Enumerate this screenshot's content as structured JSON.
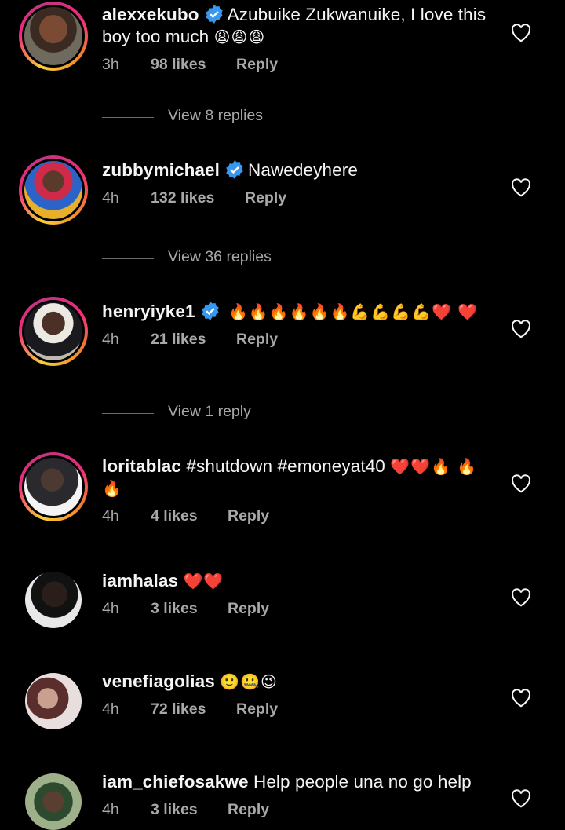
{
  "comments": [
    {
      "username": "alexxekubo",
      "verified": true,
      "text": "Azubuike Zukwanuike, I love this boy too much",
      "emojis": "😩😩😩",
      "time": "3h",
      "likes": "98 likes",
      "reply": "Reply",
      "view_replies": "View 8 replies",
      "story_ring": true
    },
    {
      "username": "zubbymichael",
      "verified": true,
      "text": "Nawedeyhere",
      "emojis": "",
      "time": "4h",
      "likes": "132 likes",
      "reply": "Reply",
      "view_replies": "View 36 replies",
      "story_ring": true
    },
    {
      "username": "henryiyke1",
      "verified": true,
      "text": "",
      "emojis": "🔥🔥🔥🔥🔥🔥💪💪💪💪❤️ ❤️",
      "time": "4h",
      "likes": "21 likes",
      "reply": "Reply",
      "view_replies": "View 1 reply",
      "story_ring": true
    },
    {
      "username": "loritablac",
      "verified": false,
      "text": "#shutdown #emoneyat40",
      "emojis": "❤️❤️🔥 🔥🔥",
      "time": "4h",
      "likes": "4 likes",
      "reply": "Reply",
      "story_ring": true
    },
    {
      "username": "iamhalas",
      "verified": false,
      "text": "",
      "emojis": "❤️❤️",
      "time": "4h",
      "likes": "3 likes",
      "reply": "Reply",
      "story_ring": false
    },
    {
      "username": "venefiagolias",
      "verified": false,
      "text": "",
      "emojis": "🙂🤐😉",
      "time": "4h",
      "likes": "72 likes",
      "reply": "Reply",
      "story_ring": false
    },
    {
      "username": "iam_chiefosakwe",
      "verified": false,
      "text": "Help people una no go help",
      "emojis": "",
      "time": "4h",
      "likes": "3 likes",
      "reply": "Reply",
      "story_ring": false
    }
  ],
  "colors": {
    "background": "#000000",
    "text": "#f5f5f5",
    "meta": "#a8a8a8",
    "verified": "#3897f0"
  }
}
